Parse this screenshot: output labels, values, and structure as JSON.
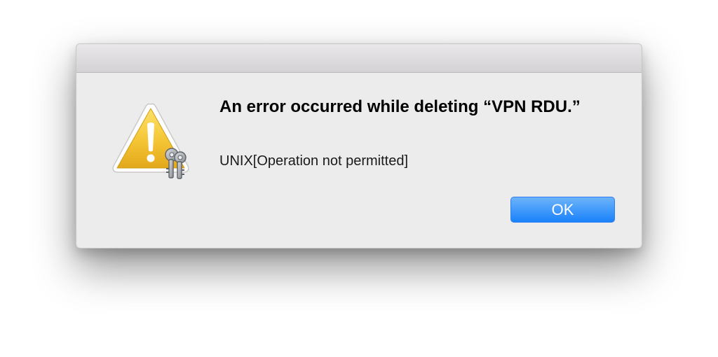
{
  "dialog": {
    "message": "An error occurred while deleting “VPN RDU.”",
    "informative_text": "UNIX[Operation not permitted]",
    "ok_label": "OK",
    "icon": "warning-keychain-icon"
  },
  "colors": {
    "dialog_bg": "#ececec",
    "button_blue": "#1a82fb",
    "warning_yellow": "#f2c53d"
  }
}
